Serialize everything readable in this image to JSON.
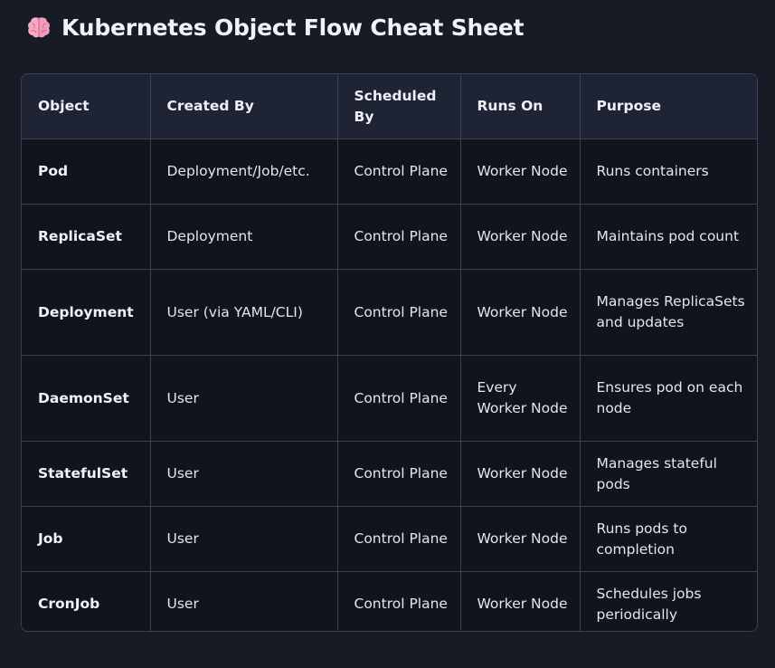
{
  "page": {
    "title": "Kubernetes Object Flow Cheat Sheet",
    "title_icon": "brain-icon"
  },
  "table": {
    "headers": [
      "Object",
      "Created By",
      "Scheduled By",
      "Runs On",
      "Purpose"
    ],
    "rows": [
      [
        "Pod",
        "Deployment/Job/etc.",
        "Control Plane",
        "Worker Node",
        "Runs containers"
      ],
      [
        "ReplicaSet",
        "Deployment",
        "Control Plane",
        "Worker Node",
        "Maintains pod count"
      ],
      [
        "Deployment",
        "User (via YAML/CLI)",
        "Control Plane",
        "Worker Node",
        "Manages ReplicaSets and updates"
      ],
      [
        "DaemonSet",
        "User",
        "Control Plane",
        "Every Worker Node",
        "Ensures pod on each node"
      ],
      [
        "StatefulSet",
        "User",
        "Control Plane",
        "Worker Node",
        "Manages stateful pods"
      ],
      [
        "Job",
        "User",
        "Control Plane",
        "Worker Node",
        "Runs pods to completion"
      ],
      [
        "CronJob",
        "User",
        "Control Plane",
        "Worker Node",
        "Schedules jobs periodically"
      ]
    ]
  },
  "colors": {
    "background": "#171b26",
    "header_row": "#1f2435",
    "body_row": "#11141d",
    "border": "#3a4154",
    "text": "#e6e8ef",
    "icon_pink": "#f7a8c4"
  }
}
